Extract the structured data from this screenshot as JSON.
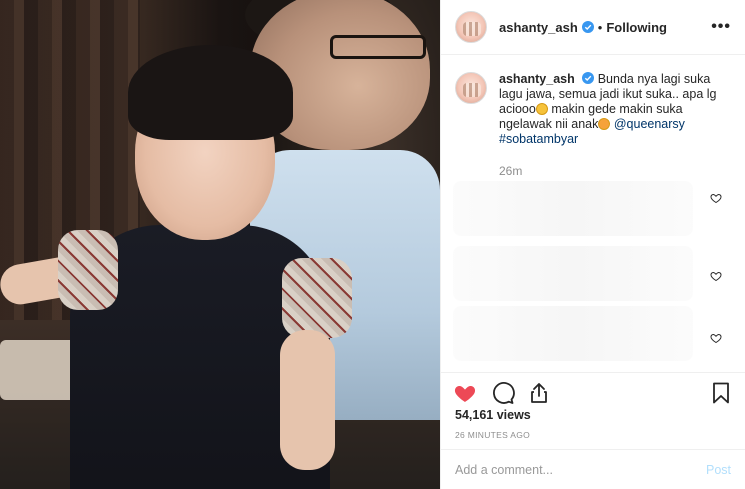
{
  "post": {
    "username": "ashanty_ash",
    "separator": "•",
    "follow_status": "Following",
    "more_label": "•••",
    "caption": {
      "username": "ashanty_ash",
      "text_part1": "Bunda nya lagi suka lagu jawa, semua jadi ikut suka.. apa lg aciooo",
      "text_part2": " makin gede makin suka ngelawak nii anak",
      "mention": "@queenarsy",
      "hashtag": "#sobatambyar",
      "time": "26m"
    },
    "views": "54,161 views",
    "posted_ago": "26 MINUTES AGO",
    "comment": {
      "placeholder": "Add a comment...",
      "post_label": "Post"
    }
  },
  "colors": {
    "liked_heart": "#ed4956",
    "verified_badge": "#3897f0",
    "post_button_disabled": "#b2dffc",
    "link": "#003569"
  },
  "icons": [
    "verified-icon",
    "more-icon",
    "heart-icon",
    "comment-icon",
    "share-icon",
    "bookmark-icon",
    "small-heart-icon",
    "emoji-grin",
    "emoji-star-eyes"
  ]
}
